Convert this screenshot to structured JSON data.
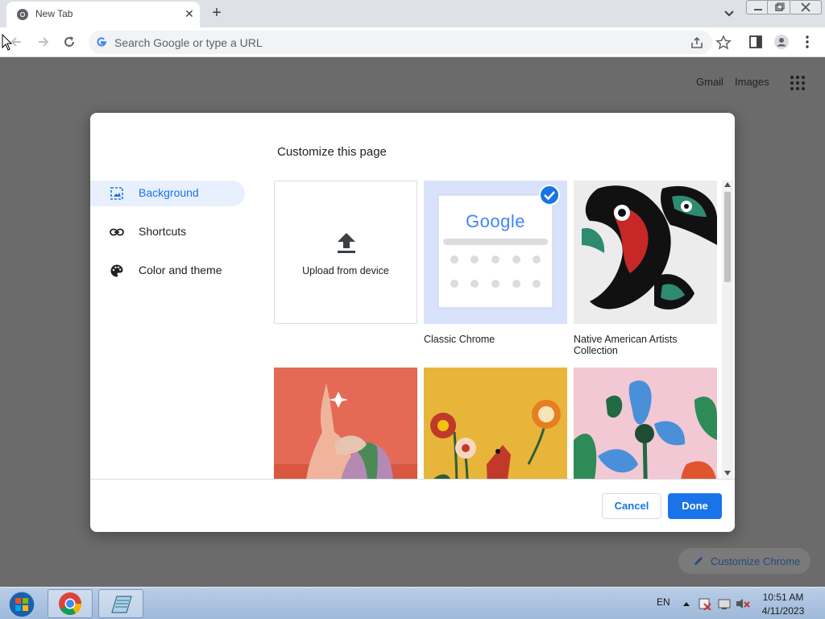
{
  "browser": {
    "tab": {
      "title": "New Tab",
      "close_glyph": "✕"
    },
    "new_tab_glyph": "+",
    "omnibox": {
      "placeholder": "Search Google or type a URL"
    }
  },
  "ntp": {
    "gmail": "Gmail",
    "images": "Images",
    "customize_chrome": "Customize Chrome"
  },
  "dialog": {
    "title": "Customize this page",
    "nav": [
      {
        "label": "Background",
        "icon": "image-icon",
        "selected": true
      },
      {
        "label": "Shortcuts",
        "icon": "link-icon",
        "selected": false
      },
      {
        "label": "Color and theme",
        "icon": "palette-icon",
        "selected": false
      }
    ],
    "tiles": {
      "upload_label": "Upload from device",
      "classic_label": "Classic Chrome",
      "classic_selected": true,
      "native_label": "Native American Artists Collection",
      "classic_logo": "Google"
    },
    "buttons": {
      "cancel": "Cancel",
      "done": "Done"
    }
  },
  "taskbar": {
    "language": "EN",
    "time": "10:51 AM",
    "date": "4/11/2023"
  },
  "colors": {
    "accent": "#1a73e8",
    "selected_nav_bg": "#e8f0fe",
    "overlay": "#6b6b6b"
  }
}
